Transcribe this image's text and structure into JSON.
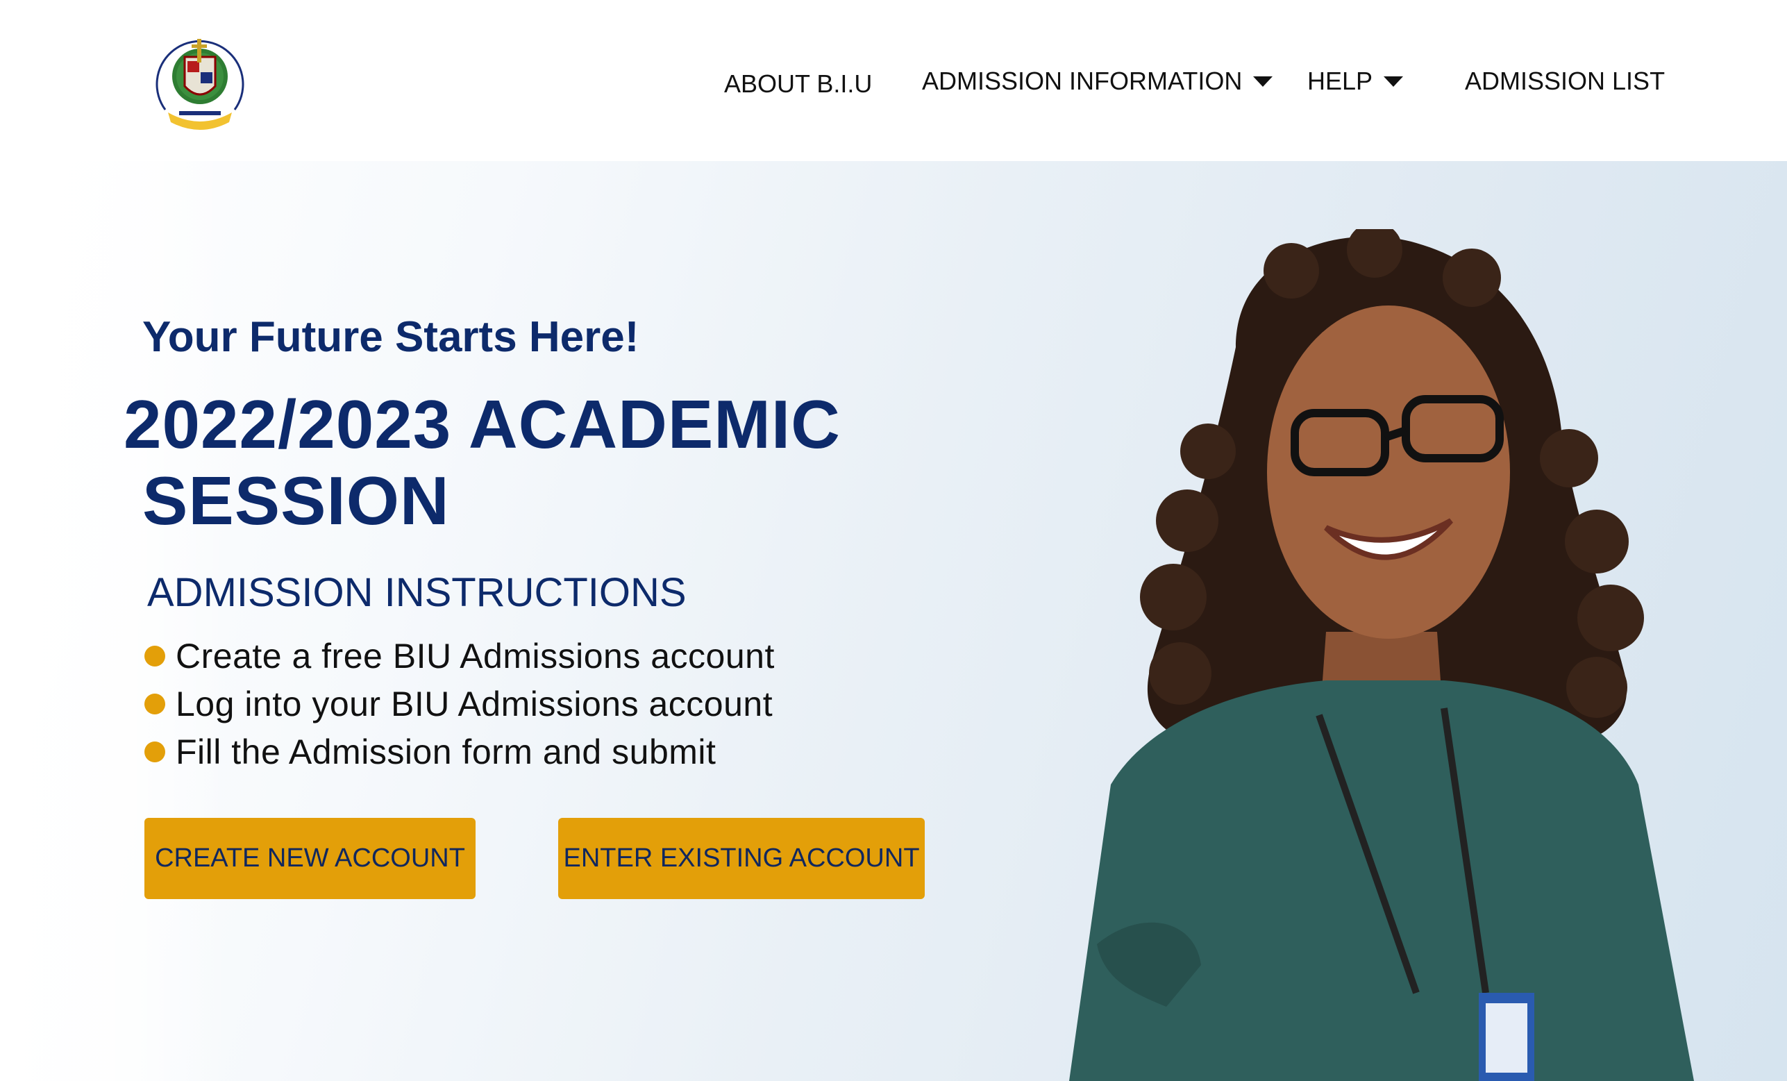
{
  "header": {
    "logo_icon": "university-crest-icon",
    "nav": {
      "about": "ABOUT B.I.U",
      "admission_information": "ADMISSION INFORMATION",
      "help": "HELP",
      "admission_list": "ADMISSION LIST"
    }
  },
  "hero": {
    "tagline": "Your Future Starts Here!",
    "session_line1": "2022/2023 ACADEMIC",
    "session_line2": "SESSION",
    "instructions_title": "ADMISSION INSTRUCTIONS",
    "instructions": [
      "Create a free BIU Admissions account",
      "Log into your BIU Admissions account",
      "Fill the Admission form and submit"
    ],
    "buttons": {
      "create": "CREATE NEW ACCOUNT",
      "enter": "ENTER EXISTING ACCOUNT"
    }
  },
  "colors": {
    "primary_navy": "#0d2a6b",
    "accent_gold": "#e39f09",
    "nav_text": "#111111"
  }
}
